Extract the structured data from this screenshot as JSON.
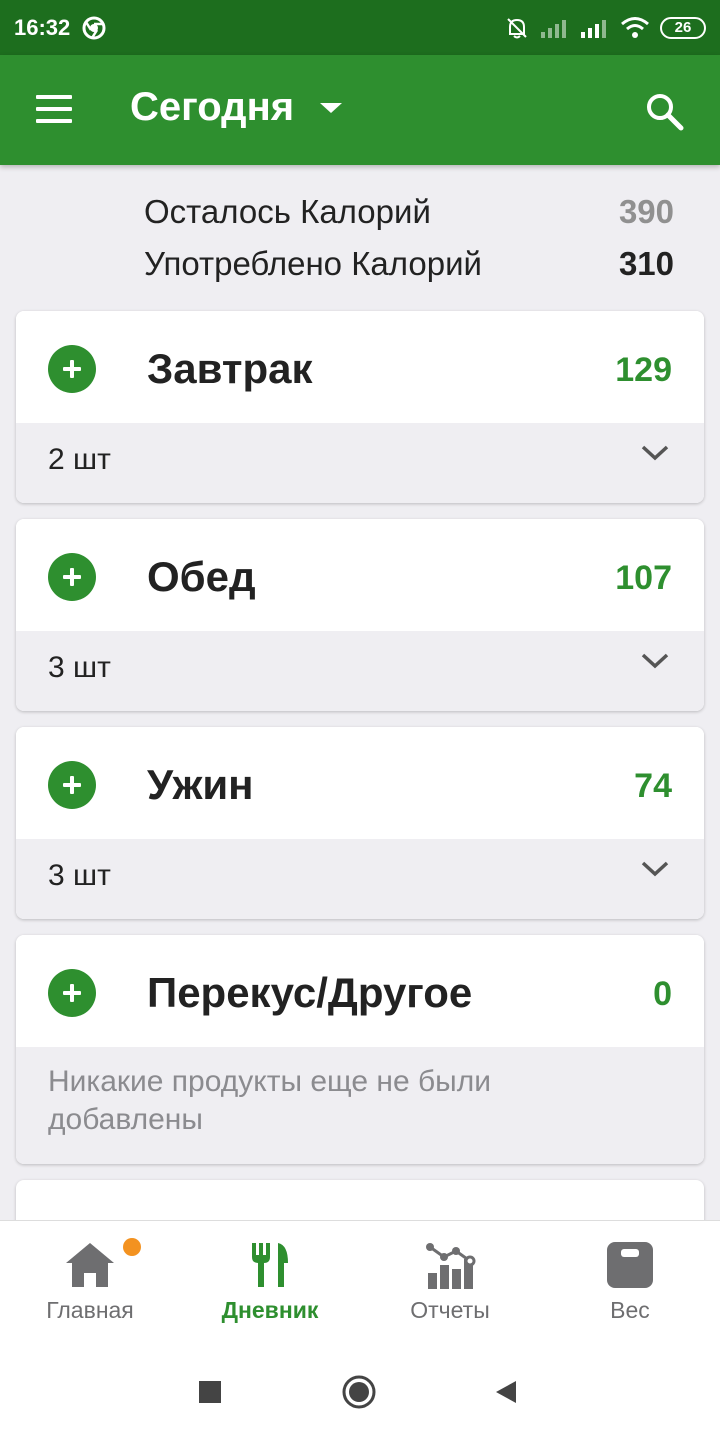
{
  "status_bar": {
    "time": "16:32",
    "battery": "26"
  },
  "app_bar": {
    "title": "Сегодня"
  },
  "summary": {
    "remaining_label": "Осталось Калорий",
    "remaining_value": "390",
    "consumed_label": "Употреблено Калорий",
    "consumed_value": "310"
  },
  "meals": [
    {
      "name": "Завтрак",
      "calories": "129",
      "count": "2 шт"
    },
    {
      "name": "Обед",
      "calories": "107",
      "count": "3 шт"
    },
    {
      "name": "Ужин",
      "calories": "74",
      "count": "3 шт"
    },
    {
      "name": "Перекус/Другое",
      "calories": "0",
      "empty_message": "Никакие продукты еще не были добавлены"
    }
  ],
  "bottom_nav": [
    {
      "label": "Главная",
      "icon": "home-icon"
    },
    {
      "label": "Дневник",
      "icon": "fork-knife-icon",
      "active": true
    },
    {
      "label": "Отчеты",
      "icon": "chart-icon"
    },
    {
      "label": "Вес",
      "icon": "scale-icon"
    }
  ],
  "colors": {
    "primary": "#2e8f2f",
    "status_bar": "#1d6e1e",
    "notification_dot": "#f39220"
  }
}
